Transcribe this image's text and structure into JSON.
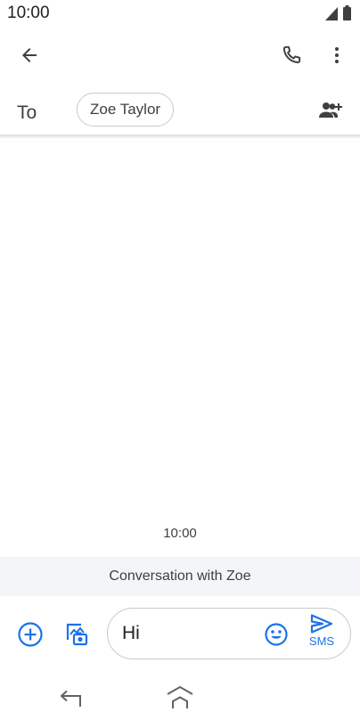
{
  "status_bar": {
    "time": "10:00",
    "icons": [
      "signal-icon",
      "battery-icon"
    ]
  },
  "app_bar": {
    "icons": [
      "back-arrow-icon",
      "phone-icon",
      "more-vert-icon"
    ]
  },
  "recipient": {
    "to_label": "To",
    "chip_name": "Zoe Taylor",
    "icon": "add-person-icon"
  },
  "conversation": {
    "timestamp": "10:00",
    "banner": "Conversation with Zoe"
  },
  "compose": {
    "message_text": "Hi",
    "send_label": "SMS",
    "icons": [
      "plus-circle-icon",
      "gallery-icon",
      "emoji-icon",
      "send-icon"
    ]
  },
  "colors": {
    "accent": "#1a73e8",
    "icon_dark": "#3c4043",
    "banner_bg": "#f4f5f8",
    "outline": "#c8cacd"
  },
  "nav_bar": {
    "icons": [
      "nav-back-icon",
      "nav-home-icon"
    ]
  }
}
